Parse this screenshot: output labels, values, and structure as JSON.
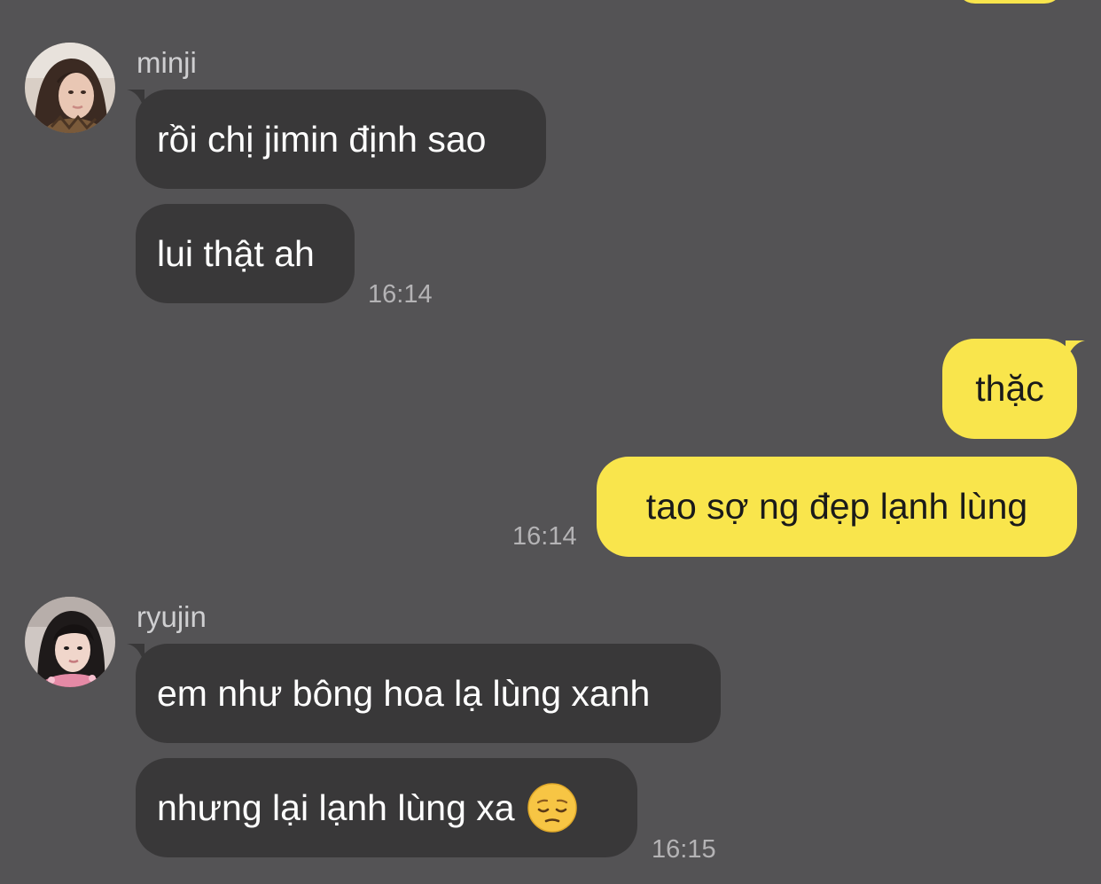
{
  "chat": {
    "groups": [
      {
        "sender": "minji",
        "avatar_icon": "profile-photo-minji",
        "messages": [
          "rồi chị jimin định sao",
          "lui thật ah"
        ],
        "time": "16:14"
      },
      {
        "sender": "me",
        "messages": [
          "thặc",
          "tao sợ ng đẹp lạnh lùng"
        ],
        "time": "16:14"
      },
      {
        "sender": "ryujin",
        "avatar_icon": "profile-photo-ryujin",
        "messages": [
          "em như bông hoa lạ lùng xanh",
          "nhưng lại lạnh lùng xa"
        ],
        "emoji": "pensive-face",
        "time": "16:15"
      }
    ]
  },
  "colors": {
    "background": "#545355",
    "incoming_bubble": "#393839",
    "outgoing_bubble": "#f9e54c",
    "timestamp": "#b4b3b5"
  }
}
